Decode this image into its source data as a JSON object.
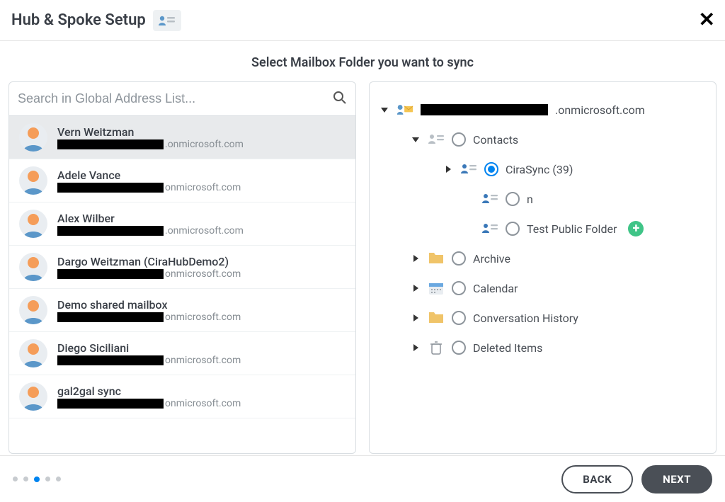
{
  "header": {
    "title": "Hub & Spoke Setup"
  },
  "subtitle": "Select Mailbox Folder you want to sync",
  "search": {
    "placeholder": "Search in Global Address List..."
  },
  "users": [
    {
      "name": "Vern Weitzman",
      "domain": ".onmicrosoft.com",
      "selected": true
    },
    {
      "name": "Adele Vance",
      "domain": "onmicrosoft.com",
      "selected": false
    },
    {
      "name": "Alex Wilber",
      "domain": ".onmicrosoft.com",
      "selected": false
    },
    {
      "name": "Dargo Weitzman (CiraHubDemo2)",
      "domain": "onmicrosoft.com",
      "selected": false
    },
    {
      "name": "Demo shared mailbox",
      "domain": "onmicrosoft.com",
      "selected": false
    },
    {
      "name": "Diego Siciliani",
      "domain": "onmicrosoft.com",
      "selected": false
    },
    {
      "name": "gal2gal sync",
      "domain": "onmicrosoft.com",
      "selected": false
    }
  ],
  "tree": {
    "root_domain": ".onmicrosoft.com",
    "nodes": {
      "contacts": {
        "label": "Contacts",
        "expanded": true
      },
      "cirasync": {
        "label": "CiraSync (39)",
        "selected": true
      },
      "n": {
        "label": "n"
      },
      "test_public": {
        "label": "Test Public Folder"
      },
      "archive": {
        "label": "Archive"
      },
      "calendar": {
        "label": "Calendar"
      },
      "conv_hist": {
        "label": "Conversation History"
      },
      "deleted": {
        "label": "Deleted Items"
      }
    }
  },
  "footer": {
    "step_count": 5,
    "active_step": 3,
    "back_label": "BACK",
    "next_label": "NEXT"
  }
}
